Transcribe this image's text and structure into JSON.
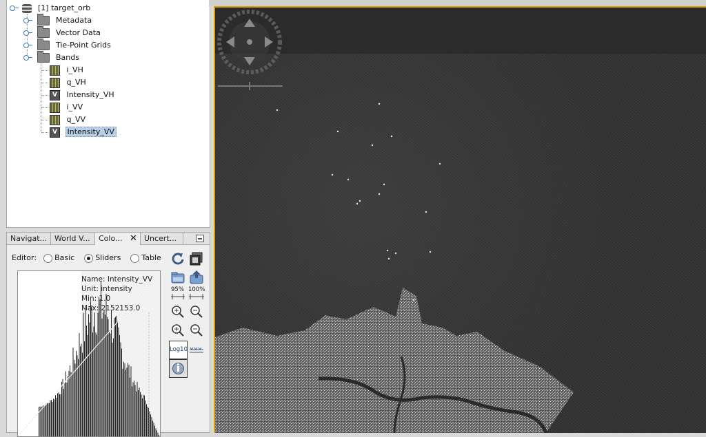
{
  "tree": {
    "root_label": "[1] target_orb",
    "folders": [
      "Metadata",
      "Vector Data",
      "Tie-Point Grids",
      "Bands"
    ],
    "bands": [
      {
        "label": "i_VH",
        "type": "band"
      },
      {
        "label": "q_VH",
        "type": "band"
      },
      {
        "label": "Intensity_VH",
        "type": "virtual"
      },
      {
        "label": "i_VV",
        "type": "band"
      },
      {
        "label": "q_VV",
        "type": "band"
      },
      {
        "label": "Intensity_VV",
        "type": "virtual",
        "selected": true
      }
    ]
  },
  "tool_tabs": [
    {
      "label": "Navigat..."
    },
    {
      "label": "World V..."
    },
    {
      "label": "Colo...",
      "active": true
    },
    {
      "label": "Uncert..."
    }
  ],
  "color_manip": {
    "editor_label": "Editor:",
    "modes": [
      "Basic",
      "Sliders",
      "Table"
    ],
    "selected_mode": "Sliders",
    "info": {
      "name": "Name: Intensity_VV",
      "unit": "Unit: intensity",
      "min": "Min: 1.0",
      "max": "Max: 2152153.0"
    },
    "zoom_labels": [
      "95%",
      "100%"
    ],
    "log_label": "Log10"
  },
  "icons": [
    "reset-icon",
    "multi-band-icon",
    "import-icon",
    "export-icon",
    "zoom-vertical-in-icon",
    "zoom-vertical-out-icon",
    "zoom-in-icon",
    "zoom-out-icon",
    "log10-icon",
    "distribute-sliders-icon",
    "info-icon",
    "navigation-compass-icon"
  ],
  "colors": {
    "accent": "#e0a000",
    "selection": "#b9cfe6"
  }
}
